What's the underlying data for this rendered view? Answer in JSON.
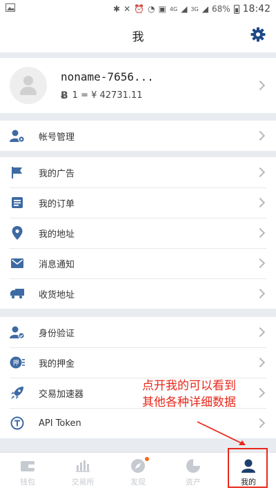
{
  "status_bar": {
    "network_4g": "4G",
    "network_3g": "3G",
    "battery": "68%",
    "time": "18:42"
  },
  "header": {
    "title": "我"
  },
  "profile": {
    "name": "noname-7656...",
    "rate": "1 = ¥ 42731.11",
    "currency_symbol": "Ƀ"
  },
  "menu_groups": [
    [
      {
        "label": "帐号管理",
        "icon": "account-manage-icon"
      }
    ],
    [
      {
        "label": "我的广告",
        "icon": "flag-icon"
      },
      {
        "label": "我的订单",
        "icon": "order-list-icon"
      },
      {
        "label": "我的地址",
        "icon": "location-pin-icon"
      },
      {
        "label": "消息通知",
        "icon": "mail-icon"
      },
      {
        "label": "收货地址",
        "icon": "truck-icon"
      }
    ],
    [
      {
        "label": "身份验证",
        "icon": "identity-verify-icon"
      },
      {
        "label": "我的押金",
        "icon": "deposit-icon"
      },
      {
        "label": "交易加速器",
        "icon": "rocket-icon"
      },
      {
        "label": "API Token",
        "icon": "api-token-icon"
      }
    ]
  ],
  "tabbar": {
    "tabs": [
      {
        "label": "钱包",
        "icon": "wallet-icon"
      },
      {
        "label": "交易所",
        "icon": "exchange-chart-icon"
      },
      {
        "label": "发现",
        "icon": "compass-icon"
      },
      {
        "label": "资产",
        "icon": "pie-chart-icon"
      },
      {
        "label": "我的",
        "icon": "user-icon"
      }
    ],
    "active_index": 4
  },
  "annotation": {
    "line1": "点开我的可以看到",
    "line2": "其他各种详细数据"
  },
  "colors": {
    "icon_blue": "#3e6aa3",
    "annotation_red": "#e8281b",
    "badge_orange": "#f26b1d"
  }
}
